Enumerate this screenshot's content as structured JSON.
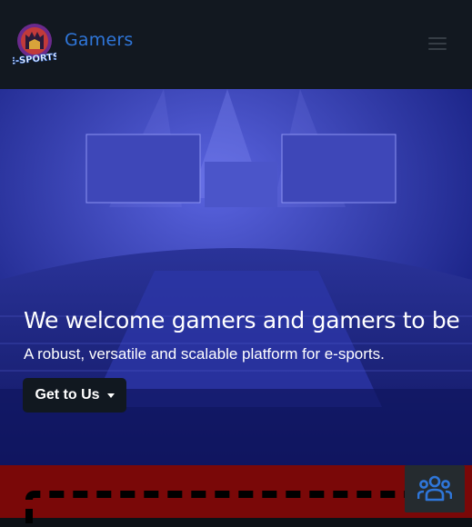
{
  "navbar": {
    "brand": "Gamers",
    "logo_text": "E-SPORTS",
    "menu_icon": "hamburger-icon"
  },
  "hero": {
    "title": "We welcome gamers and gamers to be",
    "subtitle": "A robust, versatile and scalable platform for e-sports.",
    "cta_label": "Get to Us",
    "cta_icon": "caret-down-icon",
    "overlay_color": "#1e2792"
  },
  "floating_button": {
    "icon": "users-group-icon"
  },
  "colors": {
    "brand": "#2f76d9",
    "navbar_bg": "#121820",
    "footer_bg": "#7a0808"
  }
}
